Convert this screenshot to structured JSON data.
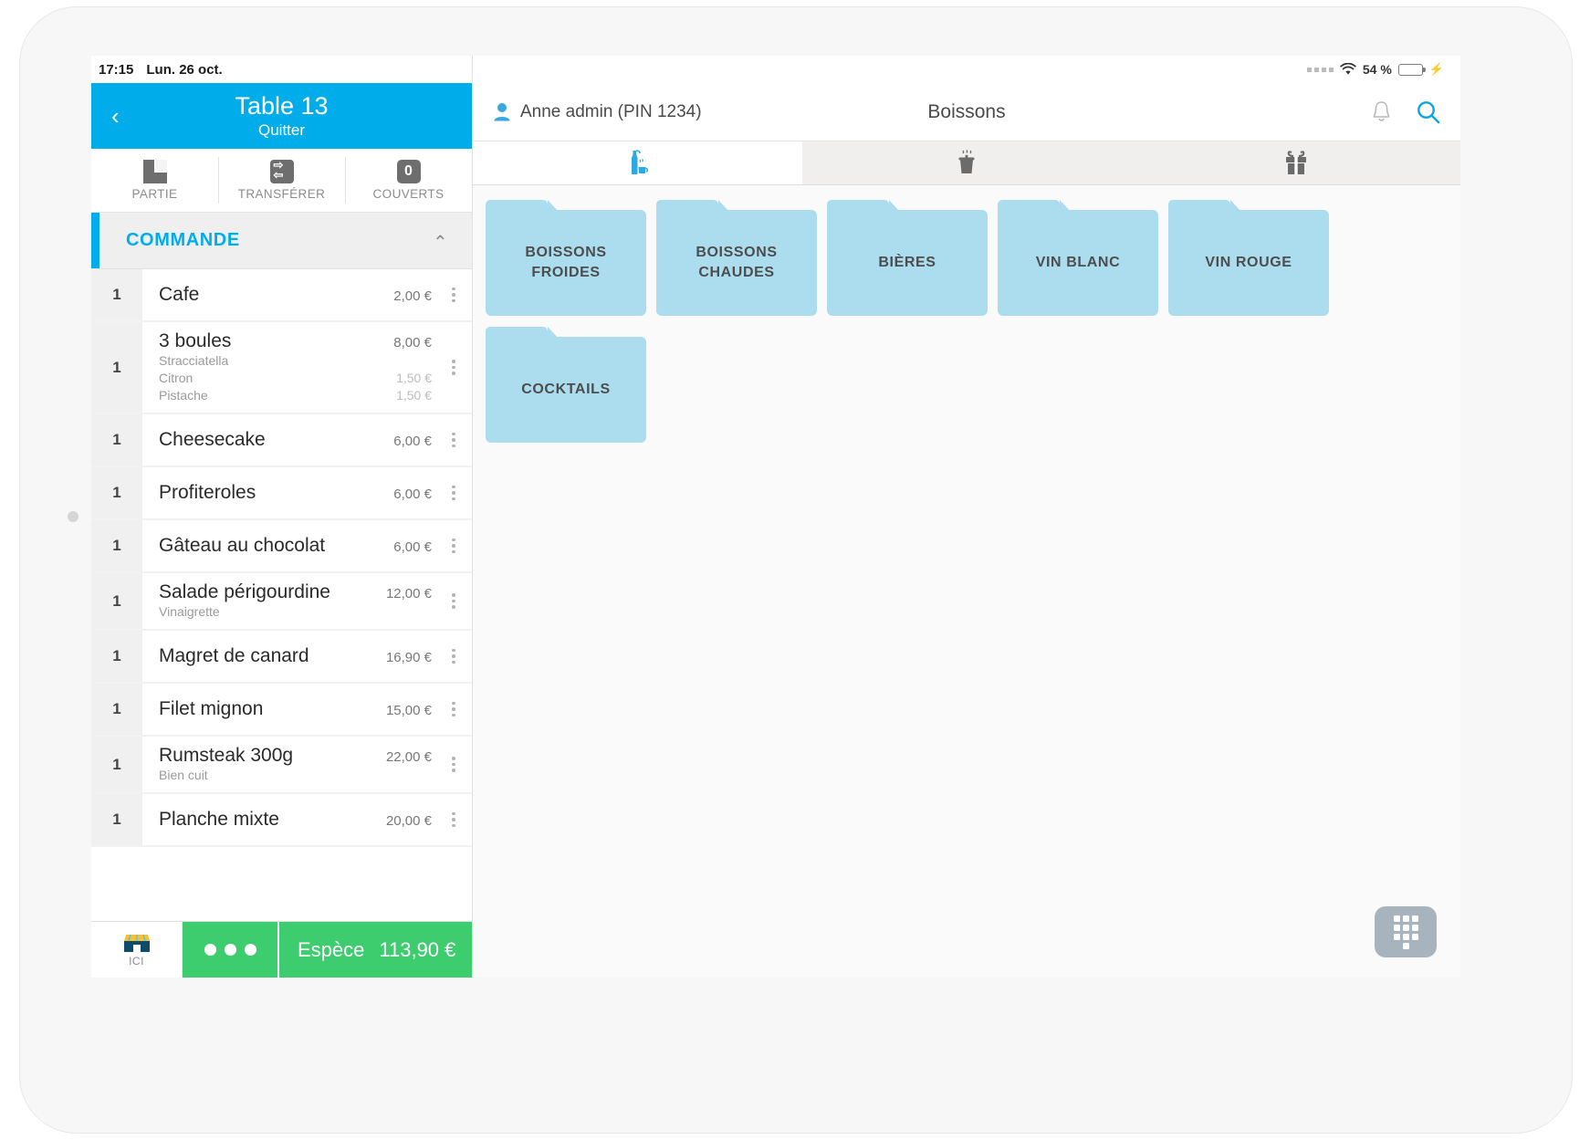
{
  "status_left": {
    "time": "17:15",
    "date": "Lun. 26 oct."
  },
  "status_right": {
    "battery_percent": "54 %",
    "wifi_icon": "wifi-icon",
    "signal_icon": "signal-dots-icon",
    "charging_icon": "charging-bolt-icon"
  },
  "table_header": {
    "back_icon": "chevron-left-icon",
    "title": "Table 13",
    "subtitle": "Quitter"
  },
  "actions": [
    {
      "label": "PARTIE",
      "icon": "split-order-icon"
    },
    {
      "label": "TRANSFÉRER",
      "icon": "transfer-arrows-icon"
    },
    {
      "label": "COUVERTS",
      "icon": "covers-count-icon",
      "value": "0"
    }
  ],
  "order_section": {
    "title": "COMMANDE",
    "collapse_icon": "chevron-up-icon",
    "accent_color": "#00adea"
  },
  "order_items": [
    {
      "qty": "1",
      "name": "Cafe",
      "price": "2,00 €",
      "options": []
    },
    {
      "qty": "1",
      "name": "3 boules",
      "price": "8,00 €",
      "options": [
        {
          "label": "Stracciatella",
          "price": ""
        },
        {
          "label": "Citron",
          "price": "1,50 €"
        },
        {
          "label": "Pistache",
          "price": "1,50 €"
        }
      ]
    },
    {
      "qty": "1",
      "name": "Cheesecake",
      "price": "6,00 €",
      "options": []
    },
    {
      "qty": "1",
      "name": "Profiteroles",
      "price": "6,00 €",
      "options": []
    },
    {
      "qty": "1",
      "name": "Gâteau au chocolat",
      "price": "6,00 €",
      "options": []
    },
    {
      "qty": "1",
      "name": "Salade périgourdine",
      "price": "12,00 €",
      "options": [
        {
          "label": "Vinaigrette",
          "price": ""
        }
      ]
    },
    {
      "qty": "1",
      "name": "Magret de canard",
      "price": "16,90 €",
      "options": []
    },
    {
      "qty": "1",
      "name": "Filet mignon",
      "price": "15,00 €",
      "options": []
    },
    {
      "qty": "1",
      "name": "Rumsteak 300g",
      "price": "22,00 €",
      "options": [
        {
          "label": "Bien cuit",
          "price": ""
        }
      ]
    },
    {
      "qty": "1",
      "name": "Planche mixte",
      "price": "20,00 €",
      "options": []
    }
  ],
  "pay_bar": {
    "here_label": "ICI",
    "here_icon": "storefront-icon",
    "more_icon": "more-dots-icon",
    "payment_label": "Espèce",
    "payment_amount": "113,90 €",
    "accent_color": "#3dcc6e"
  },
  "right_header": {
    "user_icon": "user-avatar-icon",
    "user": "Anne admin (PIN 1234)",
    "title": "Boissons",
    "bell_icon": "bell-icon",
    "search_icon": "search-icon"
  },
  "tabs": [
    {
      "icon": "drinks-icon",
      "active": true
    },
    {
      "icon": "food-pot-icon",
      "active": false
    },
    {
      "icon": "gift-icon",
      "active": false
    }
  ],
  "folders": [
    {
      "label": "BOISSONS FROIDES"
    },
    {
      "label": "BOISSONS CHAUDES"
    },
    {
      "label": "BIÈRES"
    },
    {
      "label": "VIN BLANC"
    },
    {
      "label": "VIN ROUGE"
    },
    {
      "label": "COCKTAILS"
    }
  ],
  "keypad_fab": {
    "icon": "keypad-icon"
  },
  "colors": {
    "primary": "#00adea",
    "folder": "#ABDDEE",
    "pay": "#3dcc6e"
  }
}
